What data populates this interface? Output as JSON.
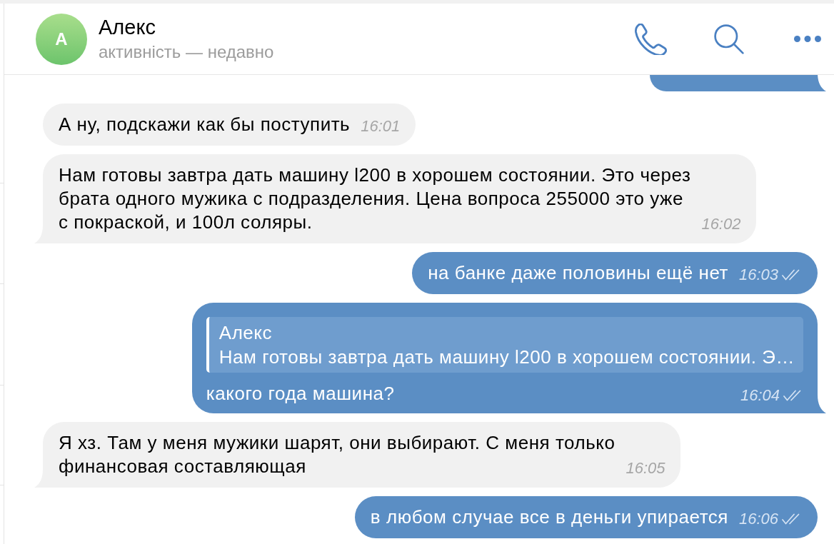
{
  "header": {
    "avatar_letter": "А",
    "name": "Алекс",
    "status": "активність — недавно"
  },
  "messages": [
    {
      "kind": "outgoing",
      "tail": true
    },
    {
      "kind": "incoming",
      "text": "А ну, подскажи как бы поступить",
      "time": "16:01",
      "tail": false
    },
    {
      "kind": "incoming",
      "text": "Нам готовы завтра дать машину l200 в хорошем состоянии. Это через\nбрата одного мужика с подразделения. Цена вопроса 255000 это уже\nс покраской, и 100л соляры.",
      "time": "16:02",
      "tail": true
    },
    {
      "kind": "outgoing",
      "text": "на банке даже половины ещё нет",
      "time": "16:03",
      "read": true,
      "tail": false
    },
    {
      "kind": "outgoing",
      "reply": {
        "author": "Алекс",
        "text": "Нам готовы завтра дать машину l200 в хорошем состоянии. Э…"
      },
      "text": "какого года машина?",
      "time": "16:04",
      "read": true,
      "tail": true
    },
    {
      "kind": "incoming",
      "text": "Я хз. Там у меня мужики шарят, они выбирают. С меня только\nфинансовая составляющая",
      "time": "16:05",
      "tail": true
    },
    {
      "kind": "outgoing",
      "text": "в любом случае все в деньги упирается",
      "time": "16:06",
      "read": true,
      "tail": false
    }
  ]
}
